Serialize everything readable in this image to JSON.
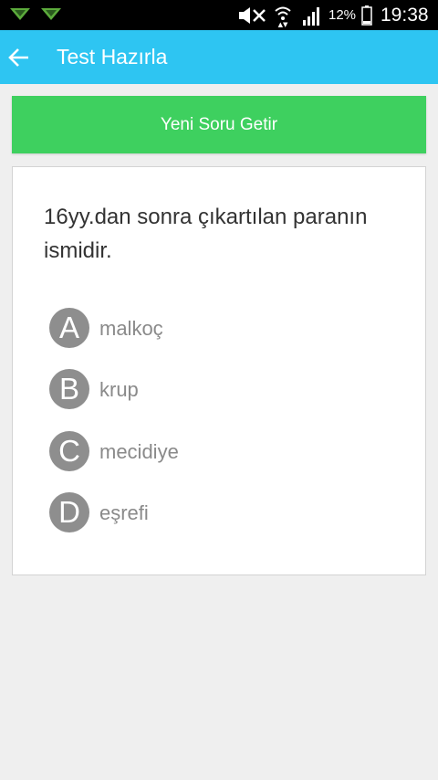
{
  "status_bar": {
    "battery_percent": "12%",
    "time": "19:38"
  },
  "app_bar": {
    "title": "Test Hazırla",
    "color": "#2ec5f2"
  },
  "new_question_button": {
    "label": "Yeni Soru Getir",
    "color": "#3ed05f"
  },
  "question": {
    "text": "16yy.dan sonra çıkartılan paranın ismidir.",
    "options": [
      {
        "letter": "A",
        "text": "malkoç"
      },
      {
        "letter": "B",
        "text": "krup"
      },
      {
        "letter": "C",
        "text": "mecidiye"
      },
      {
        "letter": "D",
        "text": "eşrefi"
      }
    ]
  },
  "icons": {
    "back": "arrow-left-icon",
    "notifications": "notification-chevron-icon",
    "mute": "mute-icon",
    "wifi": "wifi-icon",
    "signal": "signal-icon",
    "battery": "battery-icon"
  }
}
